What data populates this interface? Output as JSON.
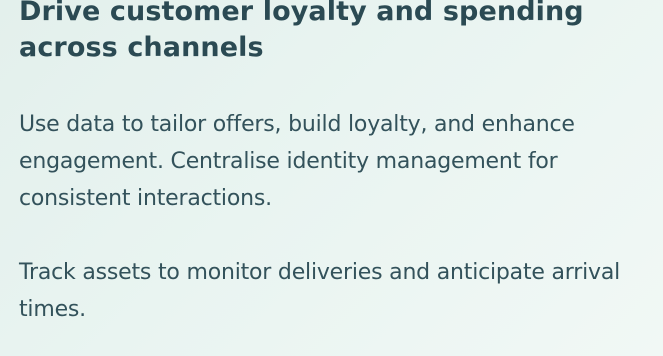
{
  "content": {
    "heading": "Drive customer loyalty and spending across channels",
    "paragraphs": [
      "Use data to tailor offers, build loyalty, and enhance engagement. Centralise identity management for consistent interactions.",
      "Track assets to monitor deliveries and anticipate arrival times."
    ]
  },
  "colors": {
    "background": "#e9f4f1",
    "heading": "#2b4a53",
    "body_text": "#33525b"
  }
}
